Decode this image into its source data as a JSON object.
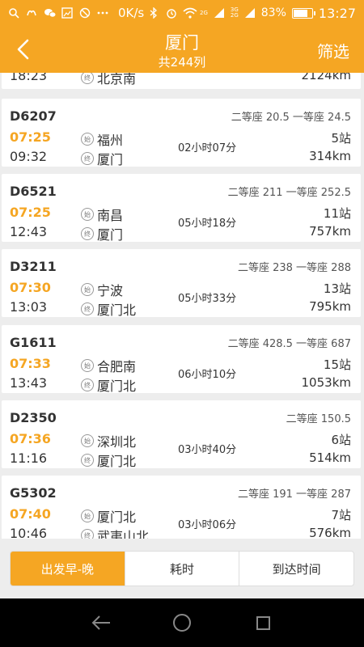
{
  "status_bar": {
    "speed": "0K/s",
    "net1": "2G",
    "net2a": "3G",
    "net2b": "2G",
    "battery": "83%",
    "battery_level": 0.83,
    "time": "13:27"
  },
  "nav": {
    "title": "厦门",
    "subtitle": "共244列",
    "filter": "筛选"
  },
  "badges": {
    "start": "始",
    "end": "终"
  },
  "partial_row": {
    "arrive": "18:23",
    "to": "北京南",
    "distance": "2124km"
  },
  "trains": [
    {
      "no": "D6207",
      "seats": "二等座 20.5 一等座 24.5",
      "depart": "07:25",
      "arrive": "09:32",
      "from": "福州",
      "to": "厦门",
      "duration": "02小时07分",
      "stops": "5站",
      "distance": "314km"
    },
    {
      "no": "D6521",
      "seats": "二等座 211 一等座 252.5",
      "depart": "07:25",
      "arrive": "12:43",
      "from": "南昌",
      "to": "厦门",
      "duration": "05小时18分",
      "stops": "11站",
      "distance": "757km"
    },
    {
      "no": "D3211",
      "seats": "二等座 238 一等座 288",
      "depart": "07:30",
      "arrive": "13:03",
      "from": "宁波",
      "to": "厦门北",
      "duration": "05小时33分",
      "stops": "13站",
      "distance": "795km"
    },
    {
      "no": "G1611",
      "seats": "二等座 428.5 一等座 687",
      "depart": "07:33",
      "arrive": "13:43",
      "from": "合肥南",
      "to": "厦门北",
      "duration": "06小时10分",
      "stops": "15站",
      "distance": "1053km"
    },
    {
      "no": "D2350",
      "seats": "二等座 150.5",
      "depart": "07:36",
      "arrive": "11:16",
      "from": "深圳北",
      "to": "厦门北",
      "duration": "03小时40分",
      "stops": "6站",
      "distance": "514km"
    },
    {
      "no": "G5302",
      "seats": "二等座 191 一等座 287",
      "depart": "07:40",
      "arrive": "10:46",
      "from": "厦门北",
      "to": "武夷山北",
      "duration": "03小时06分",
      "stops": "7站",
      "distance": "576km"
    }
  ],
  "tabs": [
    {
      "label": "出发早-晚"
    },
    {
      "label": "耗时"
    },
    {
      "label": "到达时间"
    }
  ],
  "colors": {
    "accent": "#f5a623"
  }
}
